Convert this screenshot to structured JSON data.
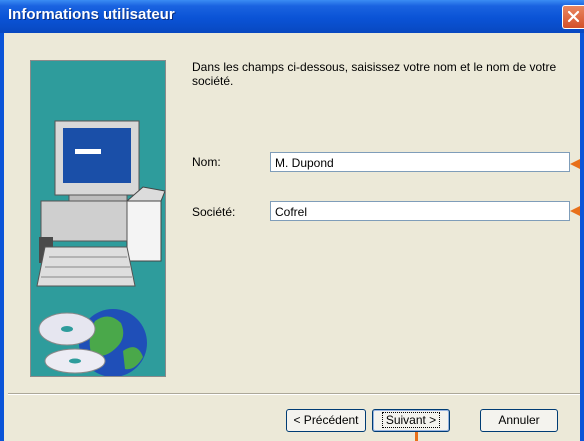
{
  "window": {
    "title": "Informations utilisateur"
  },
  "instructions": "Dans les champs ci-dessous, saisissez votre nom et le nom de votre société.",
  "fields": [
    {
      "label": "Nom:",
      "value": "M. Dupond"
    },
    {
      "label": "Société:",
      "value": "Cofrel"
    }
  ],
  "buttons": {
    "back": "< Précédent",
    "next": "Suivant >",
    "cancel": "Annuler"
  },
  "colors": {
    "titlebar": "#0a53d6",
    "dialog_bg": "#ece9d8",
    "illustration_bg": "#2e9c9c",
    "annotation_arrow": "#e8701a",
    "close_button": "#d4502a"
  },
  "icons": {
    "close": "close-icon",
    "illustration": "computer-and-cds-illustration"
  }
}
